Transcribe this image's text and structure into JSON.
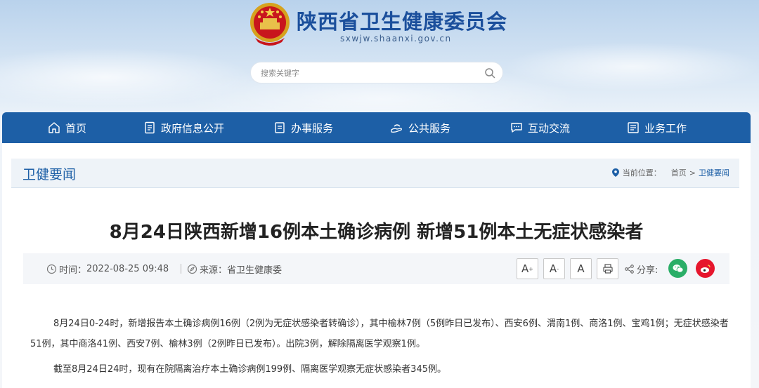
{
  "header": {
    "site_title": "陕西省卫生健康委员会",
    "site_domain": "sxwjw.shaanxi.gov.cn",
    "search_placeholder": "搜索关键字"
  },
  "nav": {
    "items": [
      {
        "label": "首页",
        "icon": "home-icon"
      },
      {
        "label": "政府信息公开",
        "icon": "document-icon"
      },
      {
        "label": "办事服务",
        "icon": "clipboard-icon"
      },
      {
        "label": "公共服务",
        "icon": "hand-service-icon"
      },
      {
        "label": "互动交流",
        "icon": "chat-icon"
      },
      {
        "label": "业务工作",
        "icon": "briefcase-icon"
      }
    ]
  },
  "section": {
    "title": "卫健要闻",
    "breadcrumb_label": "当前位置：",
    "breadcrumb_home": "首页",
    "breadcrumb_sep": ">",
    "breadcrumb_current": "卫健要闻"
  },
  "article": {
    "title": "8月24日陕西新增16例本土确诊病例 新增51例本土无症状感染者",
    "time_label": "时间：",
    "time_value": "2022-08-25 09:48",
    "source_label": "来源：",
    "source_value": "省卫生健康委",
    "font_large": "A",
    "font_large_sup": "+",
    "font_small": "A",
    "font_small_sup": "-",
    "font_normal": "A",
    "share_label": "分享:",
    "paragraph1": "8月24日0-24时，新增报告本土确诊病例16例（2例为无症状感染者转确诊），其中榆林7例（5例昨日已发布）、西安6例、渭南1例、商洛1例、宝鸡1例；无症状感染者51例，其中商洛41例、西安7例、榆林3例（2例昨日已发布）。出院3例，解除隔离医学观察1例。",
    "paragraph2": "截至8月24日24时，现有在院隔离治疗本土确诊病例199例、隔离医学观察无症状感染者345例。"
  },
  "colors": {
    "nav_bg": "#1d5fa6",
    "wechat": "#2aae67",
    "weibo": "#e6162d"
  }
}
